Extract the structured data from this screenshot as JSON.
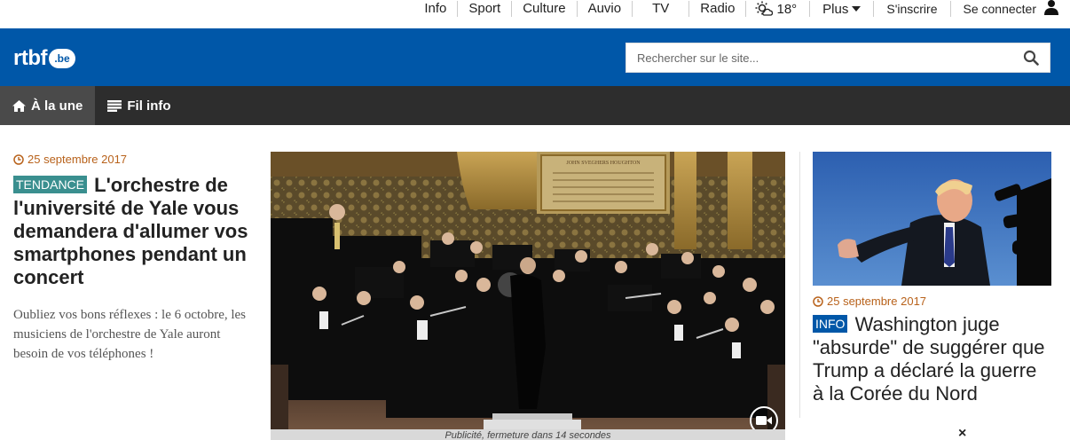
{
  "topnav": {
    "items": [
      "Info",
      "Sport",
      "Culture",
      "Auvio",
      "TV",
      "Radio"
    ],
    "weather_temp": "18°",
    "plus_label": "Plus",
    "signup_label": "S'inscrire",
    "login_label": "Se connecter"
  },
  "header": {
    "logo_text": "rtbf",
    "logo_suffix": ".be",
    "search_placeholder": "Rechercher sur le site..."
  },
  "subnav": {
    "home_label": "À la une",
    "news_label": "Fil info"
  },
  "left_article": {
    "date": "25 septembre 2017",
    "badge": "TENDANCE",
    "headline": "L'orchestre de l'université de Yale vous demandera d'allumer vos smartphones pendant un concert",
    "excerpt": "Oubliez vos bons réflexes : le 6 octobre, les musiciens de l'orchestre de Yale auront besoin de vos téléphones !"
  },
  "hero": {
    "plaque_text": "JOHN SVEGHERS HOUGHTON",
    "ad_text": "Publicité, fermeture dans 14 secondes"
  },
  "right_article": {
    "date": "25 septembre 2017",
    "badge": "INFO",
    "headline": "Washington juge \"absurde\" de suggérer que Trump a déclaré la guerre à la Corée du Nord"
  },
  "close_label": "×",
  "colors": {
    "brand_blue": "#0057a8",
    "subnav_bg": "#2d2d2d",
    "date_orange": "#b8621b",
    "tendance_teal": "#3a8f8f"
  },
  "icons": [
    "sun-cloud-icon",
    "caret-down-icon",
    "user-icon",
    "search-icon",
    "home-icon",
    "list-icon",
    "clock-icon",
    "video-camera-icon",
    "close-icon"
  ]
}
